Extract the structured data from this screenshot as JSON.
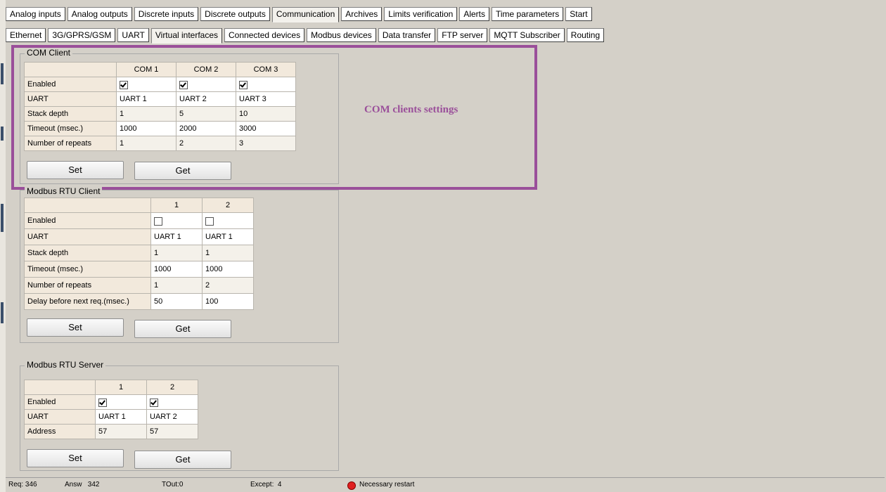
{
  "main_tabs": [
    "Analog inputs",
    "Analog outputs",
    "Discrete inputs",
    "Discrete outputs",
    "Communication",
    "Archives",
    "Limits verification",
    "Alerts",
    "Time parameters",
    "Start"
  ],
  "sub_tabs": [
    "Ethernet",
    "3G/GPRS/GSM",
    "UART",
    "Virtual interfaces",
    "Connected devices",
    "Modbus devices",
    "Data transfer",
    "FTP server",
    "MQTT Subscriber",
    "Routing"
  ],
  "com_client": {
    "title": "COM Client",
    "columns": [
      "COM 1",
      "COM 2",
      "COM 3"
    ],
    "row_labels": [
      "Enabled",
      "UART",
      "Stack depth",
      "Timeout (msec.)",
      "Number of repeats"
    ],
    "enabled": [
      true,
      true,
      true
    ],
    "uart": [
      "UART 1",
      "UART 2",
      "UART 3"
    ],
    "stack_depth": [
      "1",
      "5",
      "10"
    ],
    "timeout": [
      "1000",
      "2000",
      "3000"
    ],
    "repeats": [
      "1",
      "2",
      "3"
    ],
    "set_label": "Set",
    "get_label": "Get"
  },
  "annotation": "COM clients settings",
  "modbus_client": {
    "title": "Modbus RTU Client",
    "columns": [
      "1",
      "2"
    ],
    "row_labels": [
      "Enabled",
      "UART",
      "Stack depth",
      "Timeout (msec.)",
      "Number of repeats",
      "Delay before next req.(msec.)"
    ],
    "enabled": [
      false,
      false
    ],
    "uart": [
      "UART 1",
      "UART 1"
    ],
    "stack_depth": [
      "1",
      "1"
    ],
    "timeout": [
      "1000",
      "1000"
    ],
    "repeats": [
      "1",
      "2"
    ],
    "delay": [
      "50",
      "100"
    ],
    "set_label": "Set",
    "get_label": "Get"
  },
  "modbus_server": {
    "title": "Modbus RTU Server",
    "columns": [
      "1",
      "2"
    ],
    "row_labels": [
      "Enabled",
      "UART",
      "Address"
    ],
    "enabled": [
      true,
      true
    ],
    "uart": [
      "UART 1",
      "UART 2"
    ],
    "address": [
      "57",
      "57"
    ],
    "set_label": "Set",
    "get_label": "Get"
  },
  "status": {
    "req": "Req: 346",
    "answ": "Answ   342",
    "tout": "TOut:0",
    "except": "Except:  4",
    "restart": "Necessary restart",
    "led_color": "#e02020"
  }
}
